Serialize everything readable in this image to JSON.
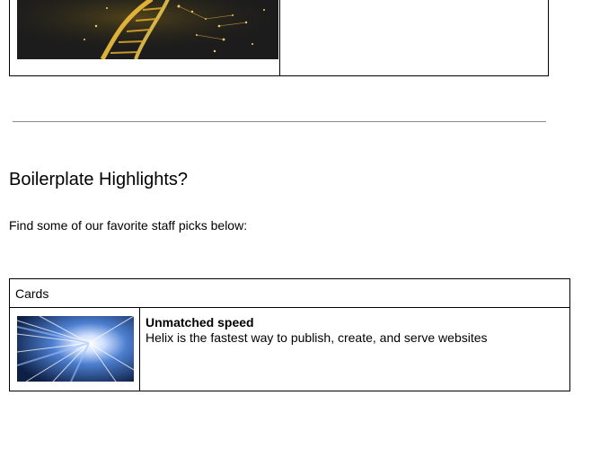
{
  "section": {
    "heading": "Boilerplate Highlights?",
    "intro": "Find some of our favorite staff picks below:"
  },
  "cards": {
    "header": "Cards",
    "items": [
      {
        "title": "Unmatched speed",
        "description": "Helix is the fastest way to publish, create, and serve websites"
      }
    ]
  }
}
